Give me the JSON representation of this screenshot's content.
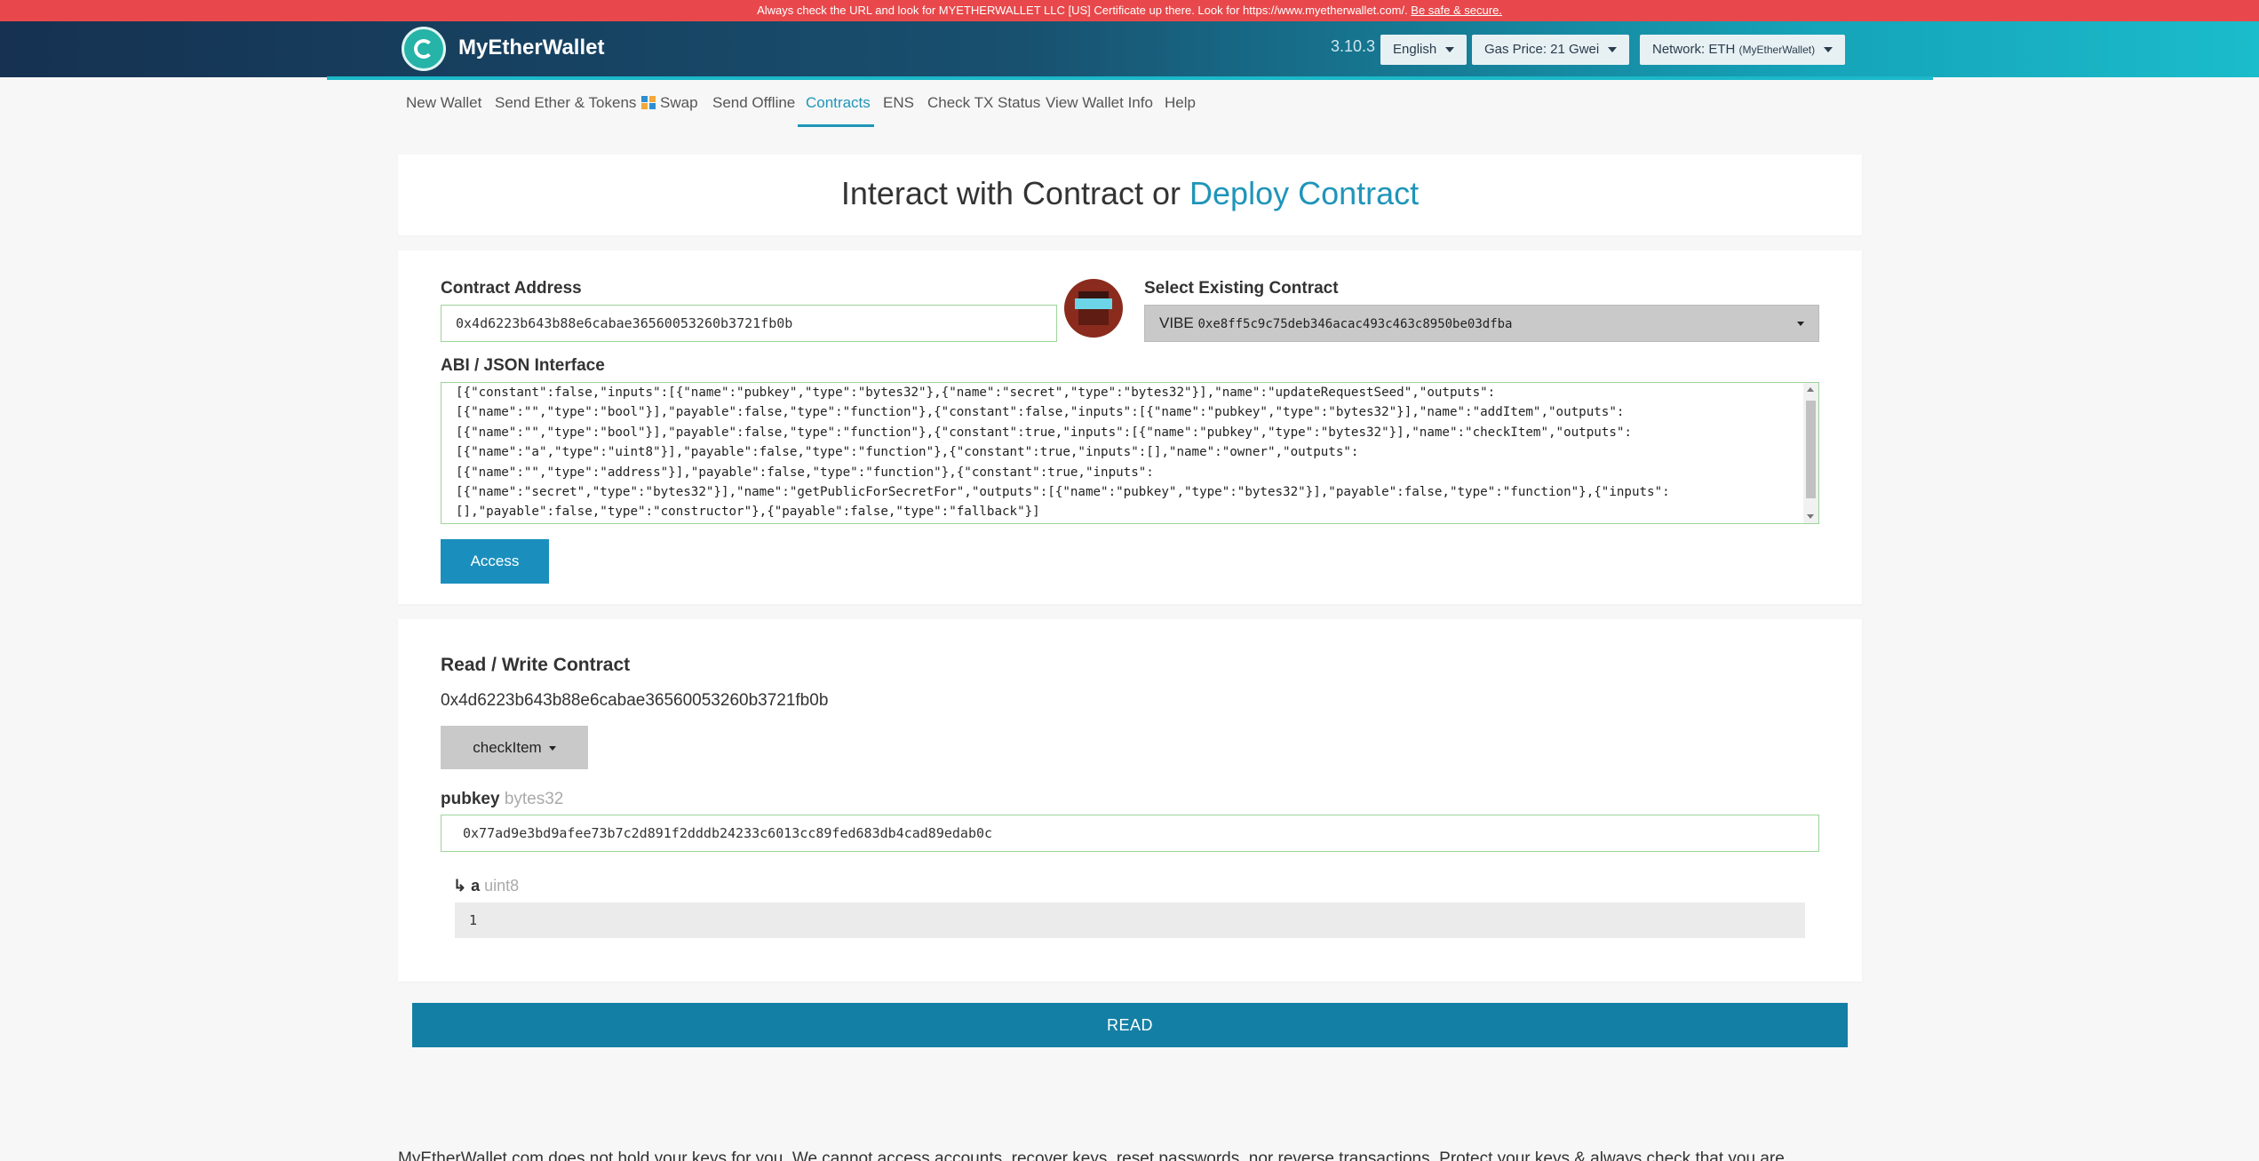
{
  "alert": {
    "text": "Always check the URL and look for MYETHERWALLET LLC [US] Certificate up there. Look for https://www.myetherwallet.com/. ",
    "link": "Be safe & secure."
  },
  "header": {
    "brand": "MyEtherWallet",
    "version": "3.10.3",
    "language": "English",
    "gas_price": "Gas Price: 21 Gwei",
    "network": "Network: ETH",
    "network_node": "(MyEtherWallet)"
  },
  "nav": {
    "items": [
      "New Wallet",
      "Send Ether & Tokens",
      "Swap",
      "Send Offline",
      "Contracts",
      "ENS",
      "Check TX Status",
      "View Wallet Info",
      "Help"
    ],
    "active": "Contracts"
  },
  "title": {
    "interact": "Interact with Contract",
    "or": "or",
    "deploy": "Deploy Contract"
  },
  "contract": {
    "address_label": "Contract Address",
    "address_value": "0x4d6223b643b88e6cabae36560053260b3721fb0b",
    "select_label": "Select Existing Contract",
    "selected_name": "VIBE",
    "selected_address": "0xe8ff5c9c75deb346acac493c463c8950be03dfba",
    "abi_label": "ABI / JSON Interface",
    "abi_lines": [
      "[{\"constant\":false,\"inputs\":[{\"name\":\"pubkey\",\"type\":\"bytes32\"},{\"name\":\"secret\",\"type\":\"bytes32\"}],\"name\":\"updateRequestSeed\",\"outputs\":",
      "[{\"name\":\"\",\"type\":\"bool\"}],\"payable\":false,\"type\":\"function\"},{\"constant\":false,\"inputs\":[{\"name\":\"pubkey\",\"type\":\"bytes32\"}],\"name\":\"addItem\",\"outputs\":",
      "[{\"name\":\"\",\"type\":\"bool\"}],\"payable\":false,\"type\":\"function\"},{\"constant\":true,\"inputs\":[{\"name\":\"pubkey\",\"type\":\"bytes32\"}],\"name\":\"checkItem\",\"outputs\":",
      "[{\"name\":\"a\",\"type\":\"uint8\"}],\"payable\":false,\"type\":\"function\"},{\"constant\":true,\"inputs\":[],\"name\":\"owner\",\"outputs\":",
      "[{\"name\":\"\",\"type\":\"address\"}],\"payable\":false,\"type\":\"function\"},{\"constant\":true,\"inputs\":",
      "[{\"name\":\"secret\",\"type\":\"bytes32\"}],\"name\":\"getPublicForSecretFor\",\"outputs\":[{\"name\":\"pubkey\",\"type\":\"bytes32\"}],\"payable\":false,\"type\":\"function\"},{\"inputs\":",
      "[],\"payable\":false,\"type\":\"constructor\"},{\"payable\":false,\"type\":\"fallback\"}]"
    ],
    "access_label": "Access"
  },
  "readwrite": {
    "heading": "Read / Write Contract",
    "address": "0x4d6223b643b88e6cabae36560053260b3721fb0b",
    "function_selected": "checkItem",
    "param_name": "pubkey",
    "param_type": "bytes32",
    "param_value": "0x77ad9e3bd9afee73b7c2d891f2dddb24233c6013cc89fed683db4cad89edab0c",
    "output_arrow": "↳",
    "output_name": "a",
    "output_type": "uint8",
    "output_value": "1",
    "read_label": "READ"
  },
  "footer": {
    "text": "MyEtherWallet.com does not hold your keys for you. We cannot access accounts, recover keys, reset passwords, nor reverse transactions. Protect your keys & always check that you are"
  },
  "colors": {
    "alert_bg": "#e8484b",
    "accent": "#1f95b9",
    "button_blue": "#1a8fbd",
    "read_button": "#137fa5",
    "valid_border": "#9ed49a"
  },
  "icons": [
    "logo-icon",
    "swap-icon",
    "caret-down-icon",
    "identicon-avatar"
  ]
}
